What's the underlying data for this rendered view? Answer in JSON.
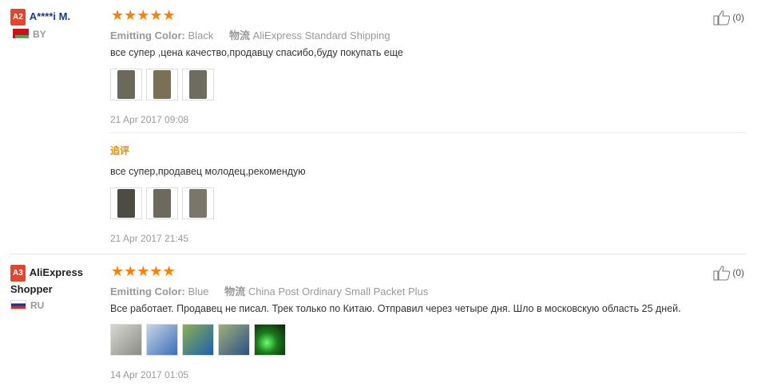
{
  "reviews": [
    {
      "badge": "A2",
      "name": "A****i M.",
      "country": "BY",
      "stars": "★★★★★",
      "color_label": "Emitting Color:",
      "color_value": "Black",
      "ship_label": "物流",
      "ship_value": "AliExpress Standard Shipping",
      "text": "все супер ,цена качество,продавцу спасибо,буду покупать еще",
      "photos": [
        "#6b6a5a",
        "#7a7058",
        "#6e6c60"
      ],
      "date": "21 Apr 2017 09:08",
      "followup_label": "追评",
      "followup_text": "все супер,продавец молодец,рекомендую",
      "followup_photos": [
        "#4d4c44",
        "#6d6a5c",
        "#7a776a"
      ],
      "followup_date": "21 Apr 2017 21:45",
      "likes": "(0)"
    },
    {
      "badge": "A3",
      "name": "AliExpress Shopper",
      "country": "RU",
      "stars": "★★★★★",
      "color_label": "Emitting Color:",
      "color_value": "Blue",
      "ship_label": "物流",
      "ship_value": "China Post Ordinary Small Packet Plus",
      "text": "Все работает. Продавец не писал. Трек только по Китаю. Отправил через четыре дня. Шло в московскую область 25 дней.",
      "photos": [
        "#a9a9a3",
        "#3a6fb7",
        "#5d8a3a",
        "#2b4f86",
        "#1a7a1a"
      ],
      "date": "14 Apr 2017 01:05",
      "likes": "(0)"
    }
  ]
}
